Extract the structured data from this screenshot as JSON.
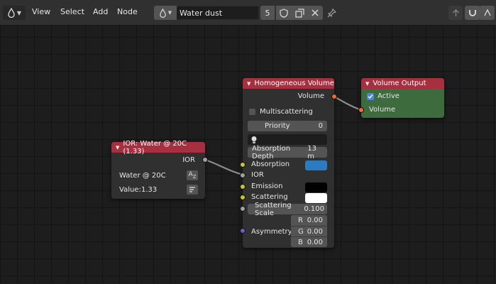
{
  "header": {
    "menu": [
      "View",
      "Select",
      "Add",
      "Node"
    ],
    "material_name": "Water dust",
    "user_count": "5"
  },
  "nodes": {
    "homogeneous_volume": {
      "title": "Homogeneous Volume",
      "output_label": "Volume",
      "multiscattering_label": "Multiscattering",
      "priority_label": "Priority",
      "priority_value": "0",
      "absorption_depth_label": "Absorption Depth",
      "absorption_depth_value": "13 m",
      "absorption_label": "Absorption",
      "ior_label": "IOR",
      "emission_label": "Emission",
      "scattering_label": "Scattering",
      "scattering_scale_label": "Scattering Scale",
      "scattering_scale_value": "0.100",
      "asymmetry_label": "Asymmetry:",
      "asymmetry": [
        {
          "axis": "R",
          "value": "0.00"
        },
        {
          "axis": "G",
          "value": "0.00"
        },
        {
          "axis": "B",
          "value": "0.00"
        }
      ],
      "colors": {
        "header": "#a63040",
        "absorption": "#2a7bc2",
        "emission": "#000000",
        "scattering": "#ffffff"
      }
    },
    "volume_output": {
      "title": "Volume Output",
      "active_label": "Active",
      "input_label": "Volume",
      "colors": {
        "header": "#a63040",
        "body": "#3e6b3e"
      }
    },
    "ior": {
      "title": "IOR: Water @ 20C (1.33)",
      "output_label": "IOR",
      "preset_label": "Water @ 20C",
      "value_label": "Value:",
      "value": "1.33",
      "colors": {
        "header": "#a63040"
      }
    }
  }
}
